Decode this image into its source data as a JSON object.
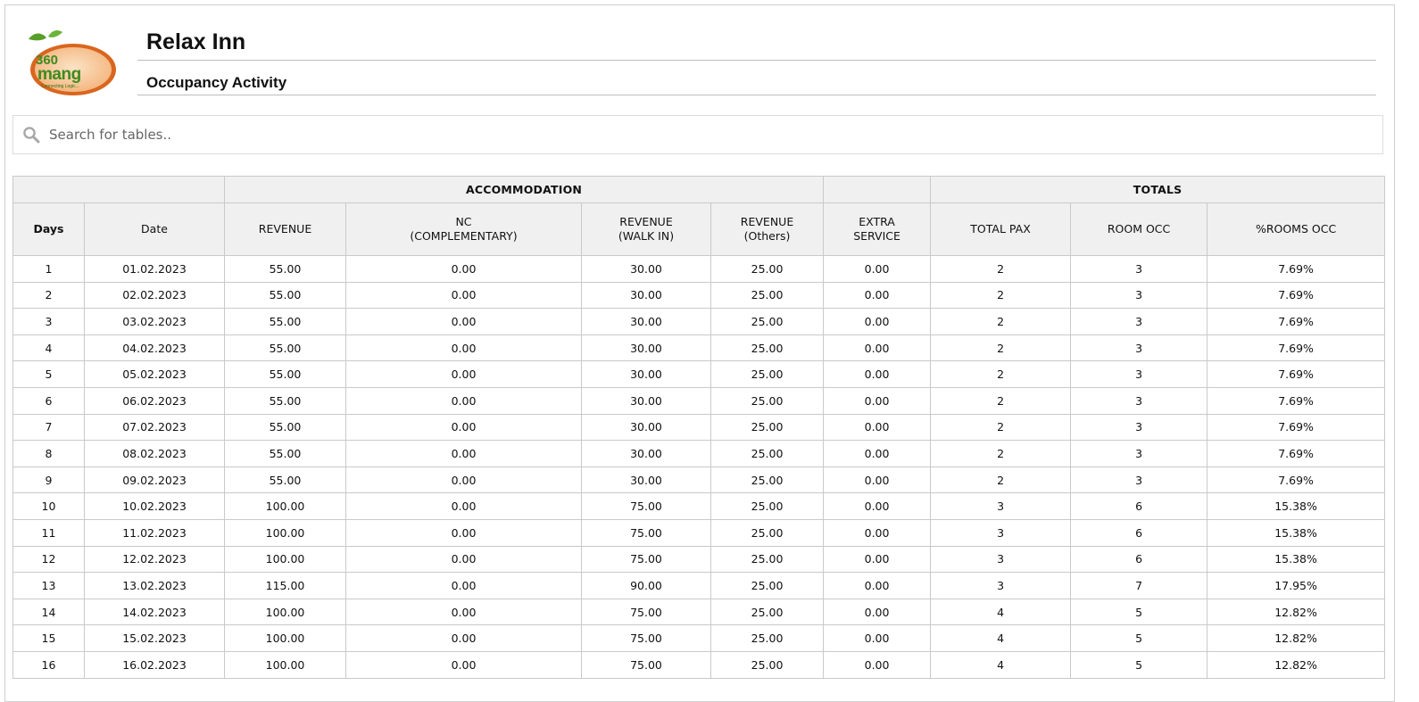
{
  "header": {
    "hotel_name": "Relax Inn",
    "report_title": "Occupancy Activity",
    "logo": {
      "text": "360 mang",
      "tagline": "Connecting Logic...",
      "brand_green": "#5a9e2a",
      "brand_orange": "#d9661f"
    }
  },
  "search": {
    "placeholder": "Search for tables..",
    "value": "",
    "icon": "search-icon"
  },
  "table": {
    "groups": {
      "accommodation": "ACCOMMODATION",
      "totals": "TOTALS"
    },
    "columns": {
      "days": "Days",
      "date": "Date",
      "revenue": "REVENUE",
      "nc_line1": "NC",
      "nc_line2": "(COMPLEMENTARY)",
      "walkin_line1": "REVENUE",
      "walkin_line2": "(WALK IN)",
      "others_line1": "REVENUE",
      "others_line2": "(Others)",
      "extra_line1": "EXTRA",
      "extra_line2": "SERVICE",
      "total_pax": "TOTAL PAX",
      "room_occ": "ROOM OCC",
      "pct_rooms_occ": "%ROOMS OCC"
    },
    "rows": [
      [
        "1",
        "01.02.2023",
        "55.00",
        "0.00",
        "30.00",
        "25.00",
        "0.00",
        "2",
        "3",
        "7.69%"
      ],
      [
        "2",
        "02.02.2023",
        "55.00",
        "0.00",
        "30.00",
        "25.00",
        "0.00",
        "2",
        "3",
        "7.69%"
      ],
      [
        "3",
        "03.02.2023",
        "55.00",
        "0.00",
        "30.00",
        "25.00",
        "0.00",
        "2",
        "3",
        "7.69%"
      ],
      [
        "4",
        "04.02.2023",
        "55.00",
        "0.00",
        "30.00",
        "25.00",
        "0.00",
        "2",
        "3",
        "7.69%"
      ],
      [
        "5",
        "05.02.2023",
        "55.00",
        "0.00",
        "30.00",
        "25.00",
        "0.00",
        "2",
        "3",
        "7.69%"
      ],
      [
        "6",
        "06.02.2023",
        "55.00",
        "0.00",
        "30.00",
        "25.00",
        "0.00",
        "2",
        "3",
        "7.69%"
      ],
      [
        "7",
        "07.02.2023",
        "55.00",
        "0.00",
        "30.00",
        "25.00",
        "0.00",
        "2",
        "3",
        "7.69%"
      ],
      [
        "8",
        "08.02.2023",
        "55.00",
        "0.00",
        "30.00",
        "25.00",
        "0.00",
        "2",
        "3",
        "7.69%"
      ],
      [
        "9",
        "09.02.2023",
        "55.00",
        "0.00",
        "30.00",
        "25.00",
        "0.00",
        "2",
        "3",
        "7.69%"
      ],
      [
        "10",
        "10.02.2023",
        "100.00",
        "0.00",
        "75.00",
        "25.00",
        "0.00",
        "3",
        "6",
        "15.38%"
      ],
      [
        "11",
        "11.02.2023",
        "100.00",
        "0.00",
        "75.00",
        "25.00",
        "0.00",
        "3",
        "6",
        "15.38%"
      ],
      [
        "12",
        "12.02.2023",
        "100.00",
        "0.00",
        "75.00",
        "25.00",
        "0.00",
        "3",
        "6",
        "15.38%"
      ],
      [
        "13",
        "13.02.2023",
        "115.00",
        "0.00",
        "90.00",
        "25.00",
        "0.00",
        "3",
        "7",
        "17.95%"
      ],
      [
        "14",
        "14.02.2023",
        "100.00",
        "0.00",
        "75.00",
        "25.00",
        "0.00",
        "4",
        "5",
        "12.82%"
      ],
      [
        "15",
        "15.02.2023",
        "100.00",
        "0.00",
        "75.00",
        "25.00",
        "0.00",
        "4",
        "5",
        "12.82%"
      ],
      [
        "16",
        "16.02.2023",
        "100.00",
        "0.00",
        "75.00",
        "25.00",
        "0.00",
        "4",
        "5",
        "12.82%"
      ]
    ]
  }
}
